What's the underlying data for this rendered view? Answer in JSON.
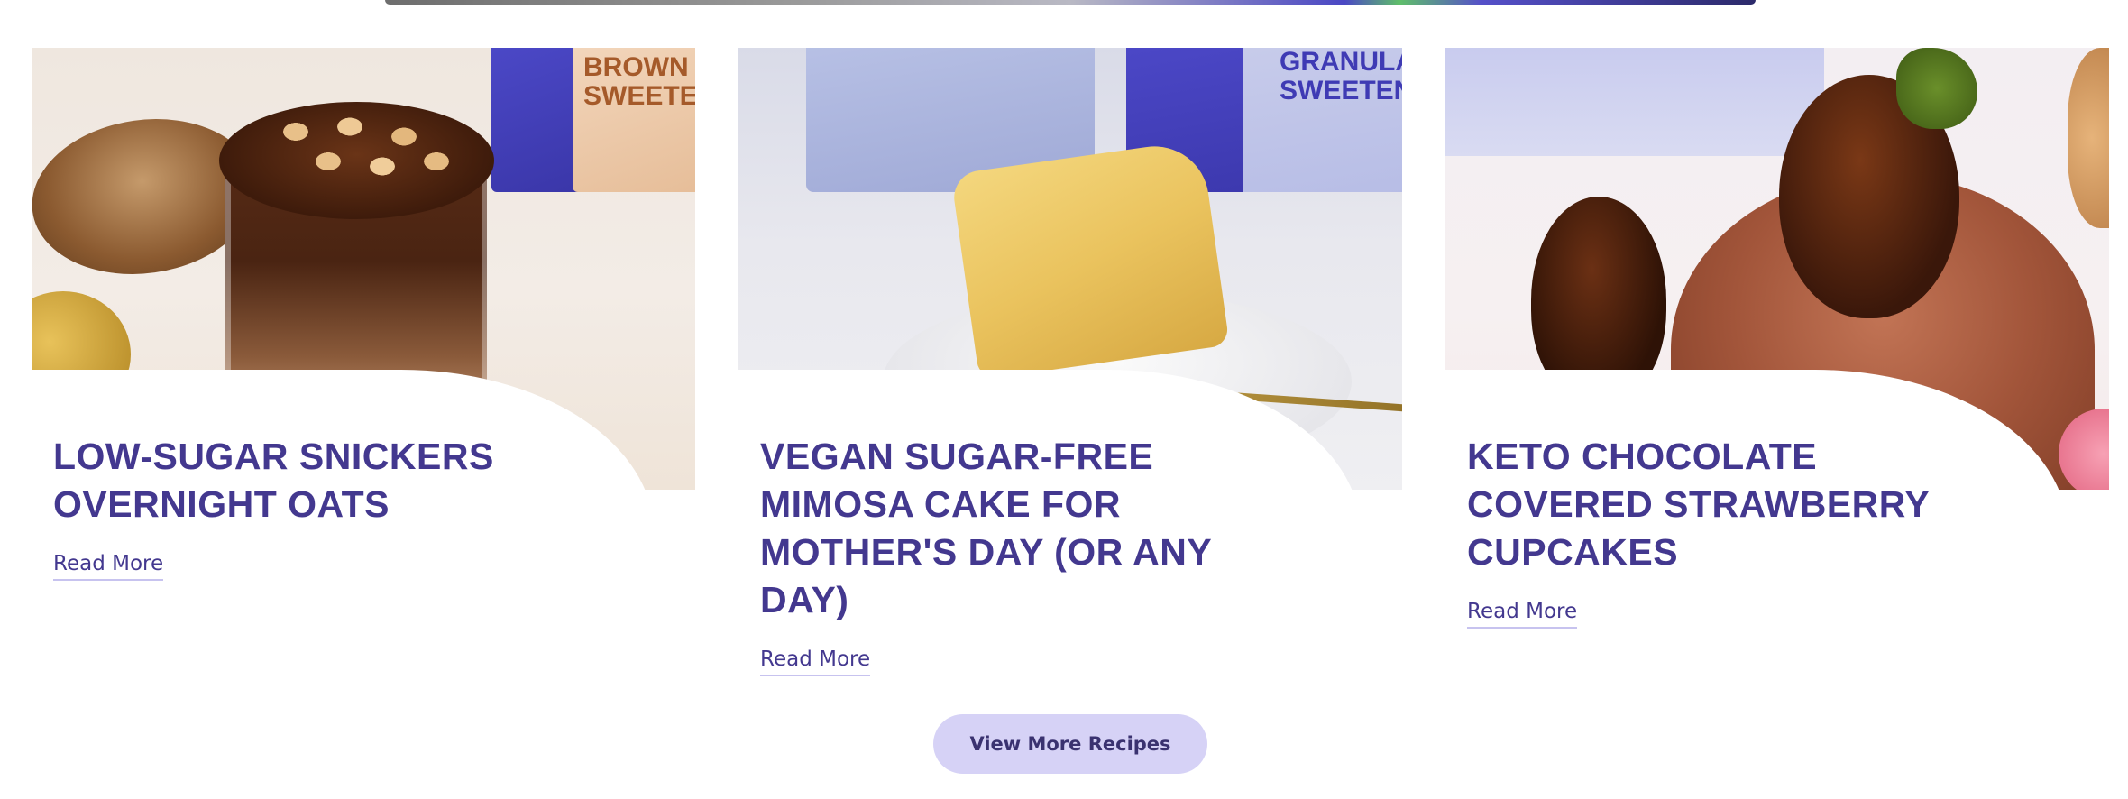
{
  "theme": {
    "accent": "#43388f",
    "cta_bg": "#d6d2f6",
    "cta_text": "#3a3270",
    "link_underline": "#c7c3ef"
  },
  "recipes": [
    {
      "title": "Low-Sugar Snickers Overnight Oats",
      "read_more": "Read More",
      "image_label": "BROWN SWEETENER"
    },
    {
      "title": "Vegan Sugar-Free Mimosa Cake for Mother's Day (or Any Day)",
      "read_more": "Read More",
      "image_label": "GRANULAR SWEETENER"
    },
    {
      "title": "Keto Chocolate Covered Strawberry Cupcakes",
      "read_more": "Read More"
    }
  ],
  "cta": {
    "label": "View More Recipes"
  }
}
